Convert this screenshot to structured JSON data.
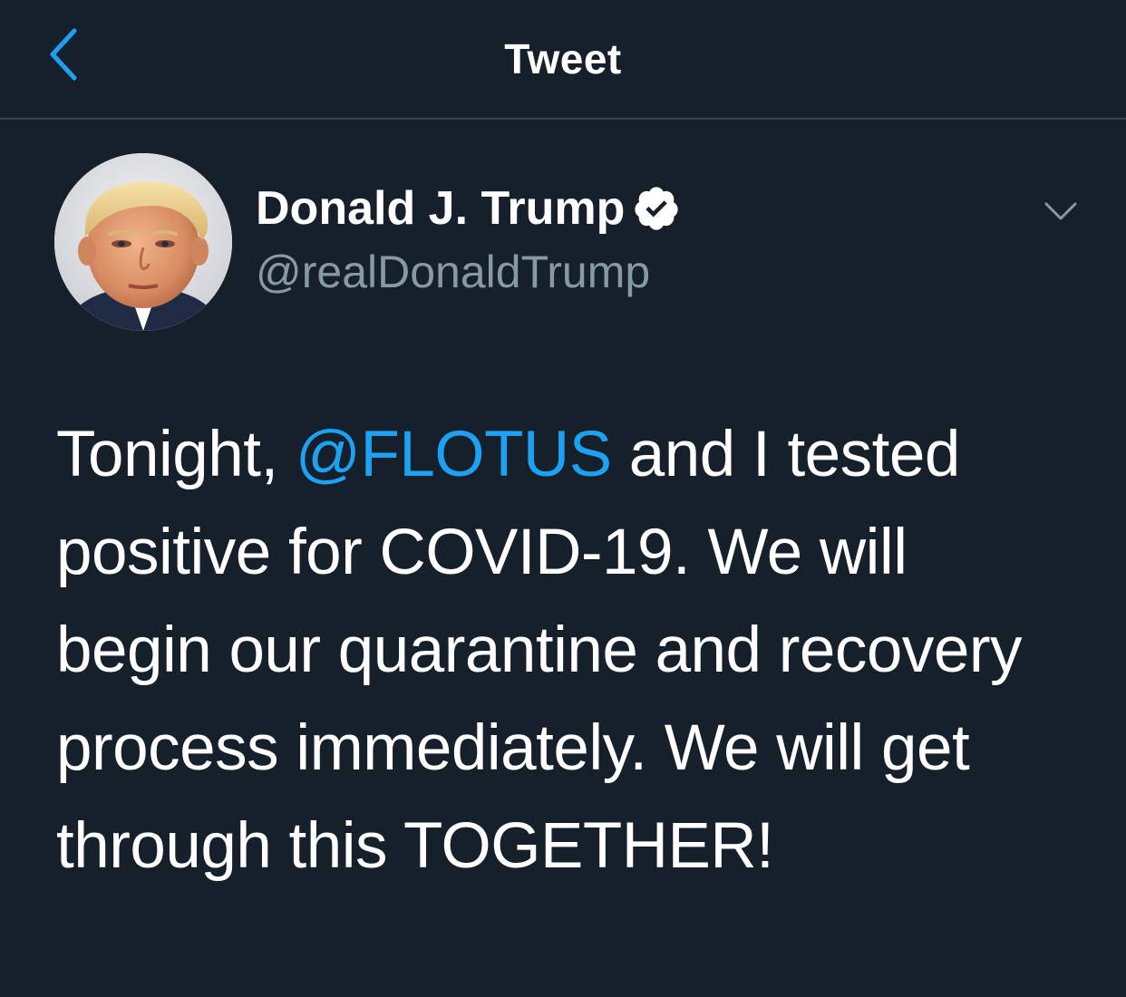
{
  "header": {
    "title": "Tweet",
    "back_icon": "chevron-left-icon"
  },
  "author": {
    "display_name": "Donald J. Trump",
    "handle": "@realDonaldTrump",
    "verified": true,
    "verified_icon": "verified-badge-icon",
    "more_icon": "chevron-down-icon"
  },
  "tweet": {
    "text_before_mention": "Tonight, ",
    "mention": "@FLOTUS",
    "text_after_mention": " and I tested positive for COVID-19. We will begin our quarantine and recovery process immediately. We will get through this TOGETHER!"
  },
  "colors": {
    "background": "#15202b",
    "accent": "#1da1f2",
    "secondary_text": "#8899a6",
    "divider": "#38444d"
  }
}
